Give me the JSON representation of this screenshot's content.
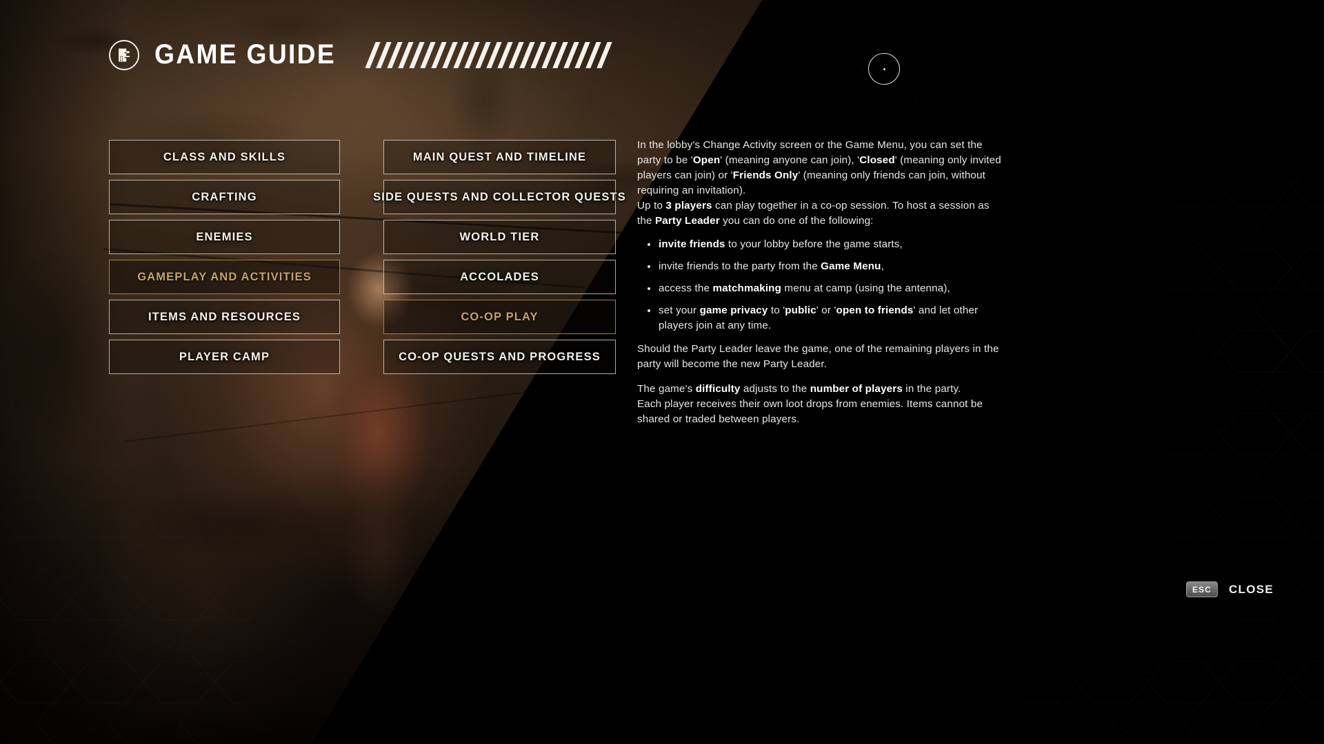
{
  "header": {
    "title": "GAME GUIDE",
    "icon": "guide-book-icon",
    "hash_mark_count": 22
  },
  "reticle": {
    "icon": "cursor-reticle-icon"
  },
  "menu": {
    "left_column": [
      {
        "label": "CLASS AND SKILLS",
        "selected": false
      },
      {
        "label": "CRAFTING",
        "selected": false
      },
      {
        "label": "ENEMIES",
        "selected": false
      },
      {
        "label": "GAMEPLAY AND ACTIVITIES",
        "selected": true
      },
      {
        "label": "ITEMS AND RESOURCES",
        "selected": false
      },
      {
        "label": "PLAYER CAMP",
        "selected": false
      }
    ],
    "right_column": [
      {
        "label": "MAIN QUEST AND TIMELINE",
        "selected": false
      },
      {
        "label": "SIDE QUESTS AND COLLECTOR QUESTS",
        "selected": false
      },
      {
        "label": "WORLD TIER",
        "selected": false
      },
      {
        "label": "ACCOLADES",
        "selected": false
      },
      {
        "label": "CO-OP PLAY",
        "selected": true
      },
      {
        "label": "CO-OP QUESTS AND PROGRESS",
        "selected": false
      }
    ]
  },
  "content": {
    "para1_a": "In the lobby's Change Activity screen or the Game Menu, you can set the party to be '",
    "para1_b": "Open",
    "para1_c": "' (meaning anyone can join), '",
    "para1_d": "Closed",
    "para1_e": "' (meaning only invited players can join) or '",
    "para1_f": "Friends Only",
    "para1_g": "' (meaning only friends can join, without requiring an invitation).",
    "para2_a": "Up to ",
    "para2_b": "3 players",
    "para2_c": " can play together in a co-op session. To host a session as the ",
    "para2_d": "Party Leader",
    "para2_e": " you can do one of the following:",
    "bullets": [
      {
        "bold_lead": "invite friends",
        "rest": " to your lobby before the game starts,"
      },
      {
        "lead": "invite friends to the party from the ",
        "bold_tail": "Game Menu",
        "tail_rest": ","
      },
      {
        "lead": "access the ",
        "bold_mid": "matchmaking",
        "rest": " menu at camp (using the antenna),"
      },
      {
        "lead": "set your ",
        "bold_mid": "game privacy",
        "mid": " to '",
        "bold_2": "public",
        "mid2": "' or '",
        "bold_3": "open to friends",
        "rest": "' and let other players join at any time."
      }
    ],
    "para3": "Should the Party Leader leave the game, one of the remaining players in the party will become the new Party Leader.",
    "para4_a": "The game's ",
    "para4_b": "difficulty",
    "para4_c": " adjusts to the ",
    "para4_d": "number of players",
    "para4_e": " in the party.",
    "para5": "Each player receives their own loot drops from enemies. Items cannot be shared or traded between players."
  },
  "footer": {
    "key": "ESC",
    "action": "CLOSE"
  },
  "colors": {
    "accent_gold": "#c9a168",
    "accent_gold_border": "#a9803f",
    "text_primary": "#f3f1ec",
    "background_black": "#000000"
  }
}
